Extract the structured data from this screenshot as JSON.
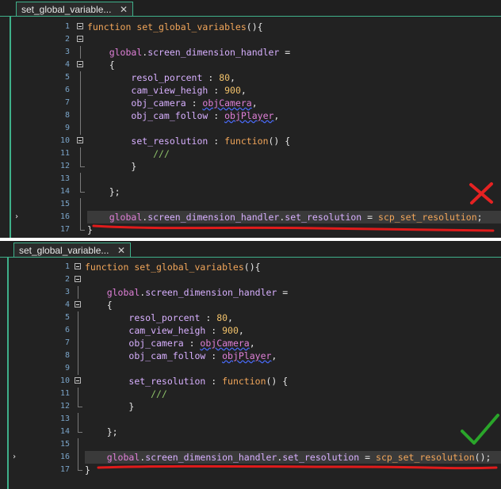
{
  "tabs": [
    {
      "title": "set_global_variable...",
      "close": "✕"
    },
    {
      "title": "set_global_variable...",
      "close": "✕"
    }
  ],
  "line_numbers": [
    "1",
    "2",
    "3",
    "4",
    "5",
    "6",
    "7",
    "8",
    "9",
    "10",
    "11",
    "12",
    "13",
    "14",
    "15",
    "16",
    "17"
  ],
  "code_top": [
    [
      [
        "kw",
        "function "
      ],
      [
        "fn",
        "set_global_variables"
      ],
      [
        "punc",
        "(){"
      ]
    ],
    [],
    [
      [
        "punc",
        "    "
      ],
      [
        "gl",
        "global"
      ],
      [
        "punc",
        "."
      ],
      [
        "pr",
        "screen_dimension_handler"
      ],
      [
        "punc",
        " ="
      ]
    ],
    [
      [
        "punc",
        "    {"
      ]
    ],
    [
      [
        "punc",
        "        "
      ],
      [
        "pr",
        "resol_porcent"
      ],
      [
        "punc",
        " : "
      ],
      [
        "num",
        "80"
      ],
      [
        "punc",
        ","
      ]
    ],
    [
      [
        "punc",
        "        "
      ],
      [
        "pr",
        "cam_view_heigh"
      ],
      [
        "punc",
        " : "
      ],
      [
        "num",
        "900"
      ],
      [
        "punc",
        ","
      ]
    ],
    [
      [
        "punc",
        "        "
      ],
      [
        "pr",
        "obj_camera"
      ],
      [
        "punc",
        " : "
      ],
      [
        "obj",
        "objCamera"
      ],
      [
        "punc",
        ","
      ]
    ],
    [
      [
        "punc",
        "        "
      ],
      [
        "pr",
        "obj_cam_follow"
      ],
      [
        "punc",
        " : "
      ],
      [
        "obj",
        "objPlayer"
      ],
      [
        "punc",
        ","
      ]
    ],
    [],
    [
      [
        "punc",
        "        "
      ],
      [
        "pr",
        "set_resolution"
      ],
      [
        "punc",
        " : "
      ],
      [
        "kw",
        "function"
      ],
      [
        "punc",
        "() {"
      ]
    ],
    [
      [
        "punc",
        "            "
      ],
      [
        "cm",
        "///"
      ]
    ],
    [
      [
        "punc",
        "        }"
      ]
    ],
    [],
    [
      [
        "punc",
        "    };"
      ]
    ],
    [],
    [
      [
        "punc",
        "    "
      ],
      [
        "gl",
        "global"
      ],
      [
        "punc",
        "."
      ],
      [
        "pr",
        "screen_dimension_handler"
      ],
      [
        "punc",
        "."
      ],
      [
        "pr",
        "set_resolution"
      ],
      [
        "punc",
        " = "
      ],
      [
        "fn",
        "scp_set_resolution"
      ],
      [
        "punc",
        ";"
      ]
    ],
    [
      [
        "punc",
        "}"
      ]
    ]
  ],
  "code_bottom": [
    [
      [
        "kw",
        "function "
      ],
      [
        "fn",
        "set_global_variables"
      ],
      [
        "punc",
        "(){"
      ]
    ],
    [],
    [
      [
        "punc",
        "    "
      ],
      [
        "gl",
        "global"
      ],
      [
        "punc",
        "."
      ],
      [
        "pr",
        "screen_dimension_handler"
      ],
      [
        "punc",
        " ="
      ]
    ],
    [
      [
        "punc",
        "    {"
      ]
    ],
    [
      [
        "punc",
        "        "
      ],
      [
        "pr",
        "resol_porcent"
      ],
      [
        "punc",
        " : "
      ],
      [
        "num",
        "80"
      ],
      [
        "punc",
        ","
      ]
    ],
    [
      [
        "punc",
        "        "
      ],
      [
        "pr",
        "cam_view_heigh"
      ],
      [
        "punc",
        " : "
      ],
      [
        "num",
        "900"
      ],
      [
        "punc",
        ","
      ]
    ],
    [
      [
        "punc",
        "        "
      ],
      [
        "pr",
        "obj_camera"
      ],
      [
        "punc",
        " : "
      ],
      [
        "obj",
        "objCamera"
      ],
      [
        "punc",
        ","
      ]
    ],
    [
      [
        "punc",
        "        "
      ],
      [
        "pr",
        "obj_cam_follow"
      ],
      [
        "punc",
        " : "
      ],
      [
        "obj",
        "objPlayer"
      ],
      [
        "punc",
        ","
      ]
    ],
    [],
    [
      [
        "punc",
        "        "
      ],
      [
        "pr",
        "set_resolution"
      ],
      [
        "punc",
        " : "
      ],
      [
        "kw",
        "function"
      ],
      [
        "punc",
        "() {"
      ]
    ],
    [
      [
        "punc",
        "            "
      ],
      [
        "cm",
        "///"
      ]
    ],
    [
      [
        "punc",
        "        }"
      ]
    ],
    [],
    [
      [
        "punc",
        "    };"
      ]
    ],
    [],
    [
      [
        "punc",
        "    "
      ],
      [
        "gl",
        "global"
      ],
      [
        "punc",
        "."
      ],
      [
        "pr",
        "screen_dimension_handler"
      ],
      [
        "punc",
        "."
      ],
      [
        "pr",
        "set_resolution"
      ],
      [
        "punc",
        " = "
      ],
      [
        "fn",
        "scp_set_resolution"
      ],
      [
        "punc",
        "();"
      ]
    ],
    [
      [
        "punc",
        "}"
      ]
    ]
  ],
  "highlight_line": 16,
  "caret_symbol": "›",
  "annotations": {
    "wrong_mark": "cross",
    "right_mark": "check",
    "underline_color": "#e01b1b",
    "cross_color": "#e52222",
    "check_color": "#2aa52a"
  }
}
